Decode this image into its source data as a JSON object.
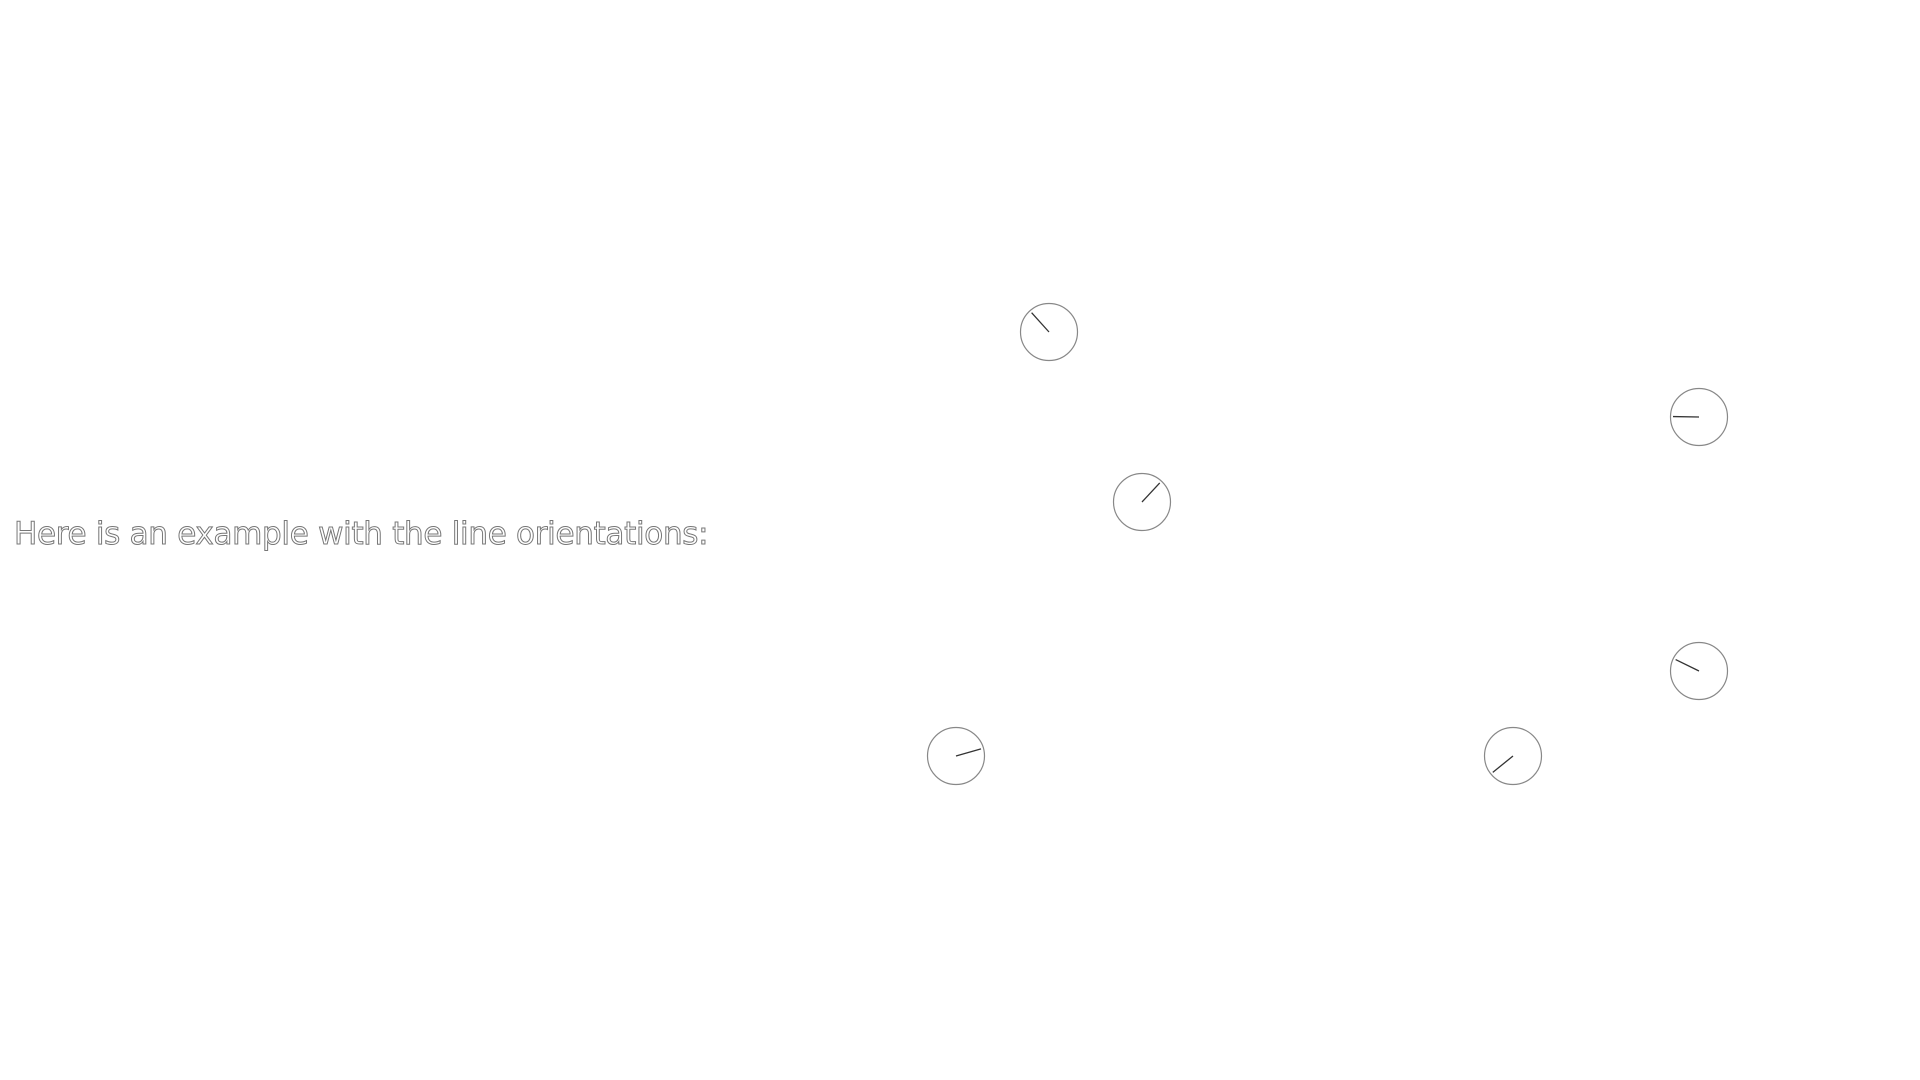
{
  "caption": "Here is an example with the line orientations:",
  "colors": {
    "background": "#ffffff",
    "circle_stroke": "#888888",
    "needle_stroke": "#333333",
    "text_outline": "#777777"
  },
  "dials": [
    {
      "name": "dial-1",
      "angle_deg": 132
    },
    {
      "name": "dial-2",
      "angle_deg": 179
    },
    {
      "name": "dial-3",
      "angle_deg": 47
    },
    {
      "name": "dial-4",
      "angle_deg": 154
    },
    {
      "name": "dial-5",
      "angle_deg": 16
    },
    {
      "name": "dial-6",
      "angle_deg": 219
    }
  ]
}
